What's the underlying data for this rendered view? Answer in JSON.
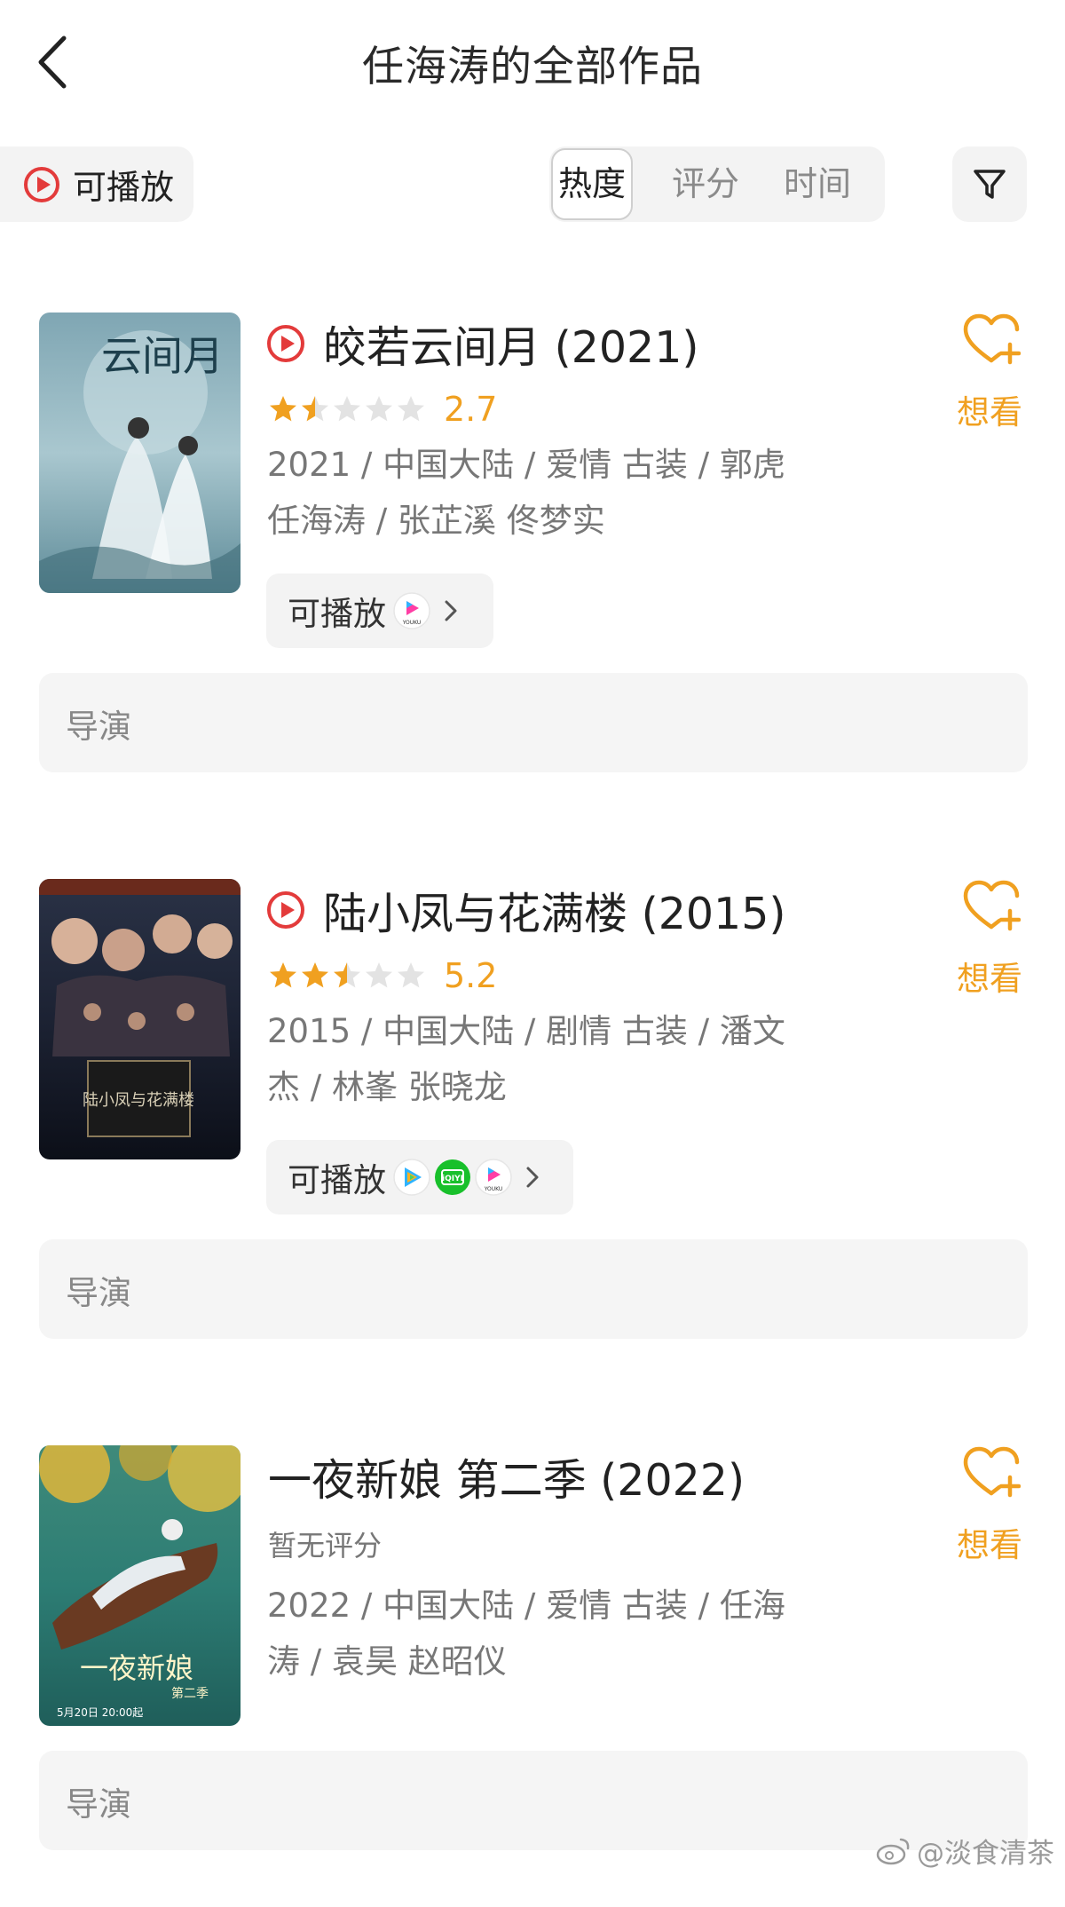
{
  "header": {
    "title": "任海涛的全部作品"
  },
  "filter": {
    "playable_label": "可播放",
    "sort_tabs": [
      "热度",
      "评分",
      "时间"
    ],
    "active_sort": "热度"
  },
  "want_label": "想看",
  "director_label": "导演",
  "works": [
    {
      "title": "皎若云间月 (2021)",
      "playable": true,
      "rating": 2.7,
      "score_text": "2.7",
      "stars": 1.5,
      "meta_line1": "2021 / 中国大陆 / 爱情 古装 / 郭虎",
      "meta_line2": "任海涛 / 张芷溪 佟梦实",
      "play_label": "可播放",
      "platforms": [
        "youku"
      ],
      "platform_labels": [
        "YOUKU"
      ]
    },
    {
      "title": "陆小凤与花满楼 (2015)",
      "playable": true,
      "rating": 5.2,
      "score_text": "5.2",
      "stars": 2.5,
      "meta_line1": "2015 / 中国大陆 / 剧情 古装 / 潘文",
      "meta_line2": "杰 / 林峯 张晓龙",
      "play_label": "可播放",
      "platforms": [
        "tencent-video",
        "iqiyi",
        "youku"
      ],
      "platform_labels": [
        "",
        "iQIYI",
        "YOUKU"
      ]
    },
    {
      "title": "一夜新娘 第二季 (2022)",
      "playable": false,
      "no_rating_text": "暂无评分",
      "meta_line1": "2022 / 中国大陆 / 爱情 古装 / 任海",
      "meta_line2": "涛 / 袁昊 赵昭仪"
    }
  ],
  "posters": [
    {
      "text": "云间月",
      "caption": ""
    },
    {
      "text": "陆小凤与花满楼",
      "caption": ""
    },
    {
      "text": "一夜新娘",
      "subtitle": "第二季",
      "date": "5月20日 20:00起"
    }
  ],
  "watermark": "@淡食清茶",
  "colors": {
    "accent": "#f0a020",
    "play_red": "#e33b3b",
    "chip_bg": "#f3f3f3"
  }
}
